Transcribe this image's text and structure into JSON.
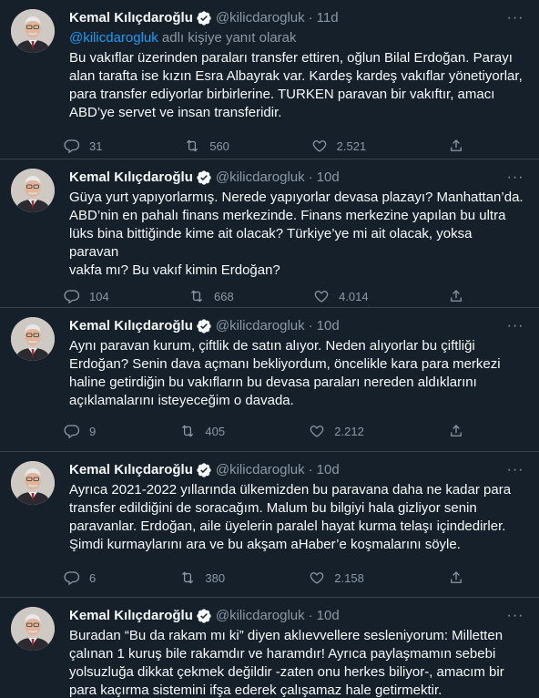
{
  "colors": {
    "background": "#15202b",
    "text": "#f7f9f9",
    "secondary": "#8b98a5",
    "accent": "#1d9bf0",
    "border": "#38444d"
  },
  "tweets": [
    {
      "name": "Kemal Kılıçdaroğlu",
      "handle": "@kilicdarogluk",
      "dot": "·",
      "time": "11d",
      "reply_mention": "@kilicdarogluk",
      "reply_suffix": " adlı kişiye yanıt olarak",
      "text": "Bu vakıflar üzerinden paraları transfer ettiren, oğlun Bilal Erdoğan. Parayı\nalan tarafta ise kızın Esra Albayrak var. Kardeş kardeş vakıflar yönetiyorlar,\npara transfer ediyorlar birbirlerine. TURKEN paravan bir vakıftır, amacı\nABD’ye servet ve insan transferidir.",
      "replies": "31",
      "retweets": "560",
      "likes": "2.521"
    },
    {
      "name": "Kemal Kılıçdaroğlu",
      "handle": "@kilicdarogluk",
      "dot": "·",
      "time": "10d",
      "text": "Güya yurt yapıyorlarmış. Nerede yapıyorlar devasa plazayı? Manhattan’da.\nABD’nin en pahalı finans merkezinde. Finans merkezine yapılan bu ultra\nlüks bina bittiğinde kime ait olacak? Türkiye’ye mi ait olacak, yoksa paravan\nvakfa mı? Bu vakıf kimin Erdoğan?",
      "replies": "104",
      "retweets": "668",
      "likes": "4.014"
    },
    {
      "name": "Kemal Kılıçdaroğlu",
      "handle": "@kilicdarogluk",
      "dot": "·",
      "time": "10d",
      "text": "Aynı paravan kurum, çiftlik de satın alıyor. Neden alıyorlar bu çiftliği\nErdoğan? Senin dava açmanı bekliyordum, öncelikle kara para merkezi\nhaline getirdiğin bu vakıfların bu devasa paraları nereden aldıklarını\naçıklamalarını isteyeceğim o davada.",
      "replies": "9",
      "retweets": "405",
      "likes": "2.212"
    },
    {
      "name": "Kemal Kılıçdaroğlu",
      "handle": "@kilicdarogluk",
      "dot": "·",
      "time": "10d",
      "text": "Ayrıca 2021-2022 yıllarında ülkemizden bu paravana daha ne kadar para\ntransfer edildiğini de soracağım. Malum bu bilgiyi hala gizliyor senin\nparavanlar. Erdoğan, aile üyelerin paralel hayat kurma telaşı içindedirler.\nŞimdi kurmaylarını ara ve bu akşam aHaber’e koşmalarını söyle.",
      "replies": "6",
      "retweets": "380",
      "likes": "2.158"
    },
    {
      "name": "Kemal Kılıçdaroğlu",
      "handle": "@kilicdarogluk",
      "dot": "·",
      "time": "10d",
      "text": "Buradan “Bu da rakam mı ki” diyen aklıevvellere sesleniyorum: Milletten\nçalınan 1 kuruş bile rakamdır ve haramdır! Ayrıca paylaşmamın sebebi\nyolsuzluğa dikkat çekmek değildir -zaten onu herkes biliyor-, amacım bir\npara kaçırma sistemini ifşa ederek çalışamaz hale getirmektir."
    }
  ]
}
